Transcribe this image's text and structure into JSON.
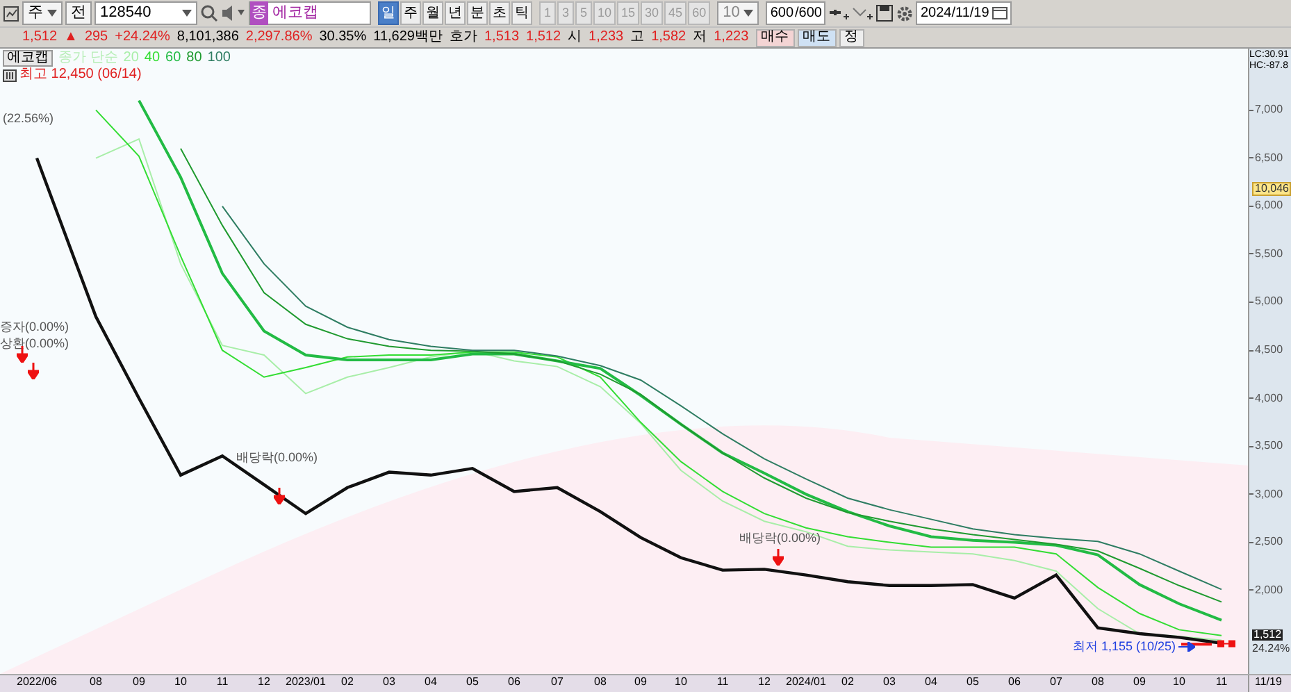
{
  "toolbar": {
    "period_dropdown": "주",
    "all_button": "전",
    "code_field": "128540",
    "stock_badge": "종",
    "stock_name": "에코캡",
    "intervals": [
      {
        "label": "일",
        "selected": true
      },
      {
        "label": "주",
        "selected": false
      },
      {
        "label": "월",
        "selected": false
      },
      {
        "label": "년",
        "selected": false
      },
      {
        "label": "분",
        "selected": false
      },
      {
        "label": "초",
        "selected": false
      },
      {
        "label": "틱",
        "selected": false
      }
    ],
    "minute_steps": [
      {
        "label": "1",
        "disabled": true
      },
      {
        "label": "3",
        "disabled": true
      },
      {
        "label": "5",
        "disabled": true
      },
      {
        "label": "10",
        "disabled": true
      },
      {
        "label": "15",
        "disabled": true
      },
      {
        "label": "30",
        "disabled": true
      },
      {
        "label": "45",
        "disabled": true
      },
      {
        "label": "60",
        "disabled": true
      }
    ],
    "step_dropdown": "10",
    "count_field": "600",
    "count_total": "/600",
    "date_field": "2024/11/19"
  },
  "quote_bar": {
    "items": [
      {
        "text": "1,512",
        "kind": "up"
      },
      {
        "text": "▲",
        "kind": "up"
      },
      {
        "text": "295",
        "kind": "up"
      },
      {
        "text": "+24.24%",
        "kind": "up"
      },
      {
        "text": "8,101,386",
        "kind": "plain"
      },
      {
        "text": "2,297.86%",
        "kind": "up"
      },
      {
        "text": "30.35%",
        "kind": "plain"
      },
      {
        "text": "11,629백만",
        "kind": "plain"
      },
      {
        "text": "호가",
        "kind": "label"
      },
      {
        "text": "1,513",
        "kind": "up"
      },
      {
        "text": "1,512",
        "kind": "up"
      },
      {
        "text": "시",
        "kind": "label"
      },
      {
        "text": "1,233",
        "kind": "up"
      },
      {
        "text": "고",
        "kind": "label"
      },
      {
        "text": "1,582",
        "kind": "up"
      },
      {
        "text": "저",
        "kind": "label"
      },
      {
        "text": "1,223",
        "kind": "up"
      }
    ],
    "buttons": [
      {
        "label": "매수",
        "kind": "buy"
      },
      {
        "label": "매도",
        "kind": "sell"
      },
      {
        "label": "정",
        "kind": "plain"
      }
    ]
  },
  "legend": {
    "series_label": "종가 단순"
  },
  "high_marker": "최고 12,450 (06/14)",
  "low_marker": "최저 1,155 (10/25)",
  "events": [
    {
      "text": "(22.56%)"
    },
    {
      "text": "증자(0.00%)"
    },
    {
      "text": "상환(0.00%)"
    },
    {
      "text": "배당락(0.00%)"
    },
    {
      "text": "배당락(0.00%)"
    }
  ],
  "indicator_readout": [
    "LC:30.91",
    "HC:-87.8"
  ],
  "price_badges": {
    "marker": "10,046",
    "current": "1,512",
    "change": "24.24%"
  },
  "chart_data": {
    "type": "line",
    "categories": [
      "2022/06",
      "08",
      "09",
      "10",
      "11",
      "12",
      "2023/01",
      "02",
      "03",
      "04",
      "05",
      "06",
      "07",
      "08",
      "09",
      "10",
      "11",
      "12",
      "2024/01",
      "02",
      "03",
      "04",
      "05",
      "06",
      "07",
      "08",
      "09",
      "10",
      "11"
    ],
    "ylim": [
      1130,
      7640
    ],
    "yticks": [
      {
        "value": 7000,
        "label": "7,000"
      },
      {
        "value": 6500,
        "label": "6,500"
      },
      {
        "value": 6000,
        "label": "6,000"
      },
      {
        "value": 5500,
        "label": "5,500"
      },
      {
        "value": 5000,
        "label": "5,000"
      },
      {
        "value": 4500,
        "label": "4,500"
      },
      {
        "value": 4000,
        "label": "4,000"
      },
      {
        "value": 3500,
        "label": "3,500"
      },
      {
        "value": 3000,
        "label": "3,000"
      },
      {
        "value": 2500,
        "label": "2,500"
      },
      {
        "value": 2000,
        "label": "2,000"
      }
    ],
    "series": [
      {
        "name": "에코캡",
        "color": "#111111",
        "values": [
          6500,
          4850,
          4000,
          3200,
          3400,
          3100,
          2800,
          3070,
          3230,
          3200,
          3270,
          3030,
          3070,
          2820,
          2550,
          2340,
          2210,
          2220,
          2160,
          2090,
          2050,
          2050,
          2060,
          1920,
          2160,
          1610,
          1550,
          1510,
          1450
        ]
      },
      {
        "name": "20",
        "color": "#a8eea8",
        "values": [
          null,
          6500,
          6700,
          5400,
          4550,
          4450,
          4050,
          4220,
          4320,
          4430,
          4490,
          4390,
          4330,
          4120,
          3740,
          3250,
          2930,
          2720,
          2610,
          2460,
          2420,
          2400,
          2380,
          2310,
          2200,
          1810,
          1550,
          1520,
          1480
        ]
      },
      {
        "name": "40",
        "color": "#33dd33",
        "values": [
          null,
          7000,
          6520,
          5480,
          4500,
          4220,
          4320,
          4430,
          4450,
          4450,
          4480,
          4480,
          4430,
          4220,
          3750,
          3340,
          3030,
          2800,
          2650,
          2560,
          2500,
          2450,
          2450,
          2450,
          2380,
          2030,
          1760,
          1590,
          1530
        ]
      },
      {
        "name": "60",
        "color": "#22bb44",
        "values": [
          null,
          null,
          7100,
          6300,
          5300,
          4700,
          4450,
          4400,
          4400,
          4400,
          4460,
          4460,
          4390,
          4310,
          4030,
          3730,
          3430,
          3220,
          3000,
          2820,
          2670,
          2560,
          2520,
          2500,
          2470,
          2370,
          2060,
          1860,
          1690
        ]
      },
      {
        "name": "80",
        "color": "#1f9a2f",
        "values": [
          null,
          null,
          null,
          6600,
          5800,
          5100,
          4770,
          4620,
          4540,
          4500,
          4490,
          4460,
          4390,
          4250,
          4040,
          3730,
          3430,
          3170,
          2960,
          2810,
          2720,
          2640,
          2580,
          2530,
          2480,
          2410,
          2230,
          2050,
          1880
        ]
      },
      {
        "name": "100",
        "color": "#2e7d62",
        "values": [
          null,
          null,
          null,
          null,
          6000,
          5400,
          4960,
          4740,
          4610,
          4540,
          4500,
          4500,
          4440,
          4340,
          4190,
          3920,
          3630,
          3370,
          3160,
          2960,
          2840,
          2740,
          2640,
          2580,
          2540,
          2510,
          2380,
          2200,
          2010
        ]
      }
    ]
  },
  "date_axis_end": "11/19"
}
